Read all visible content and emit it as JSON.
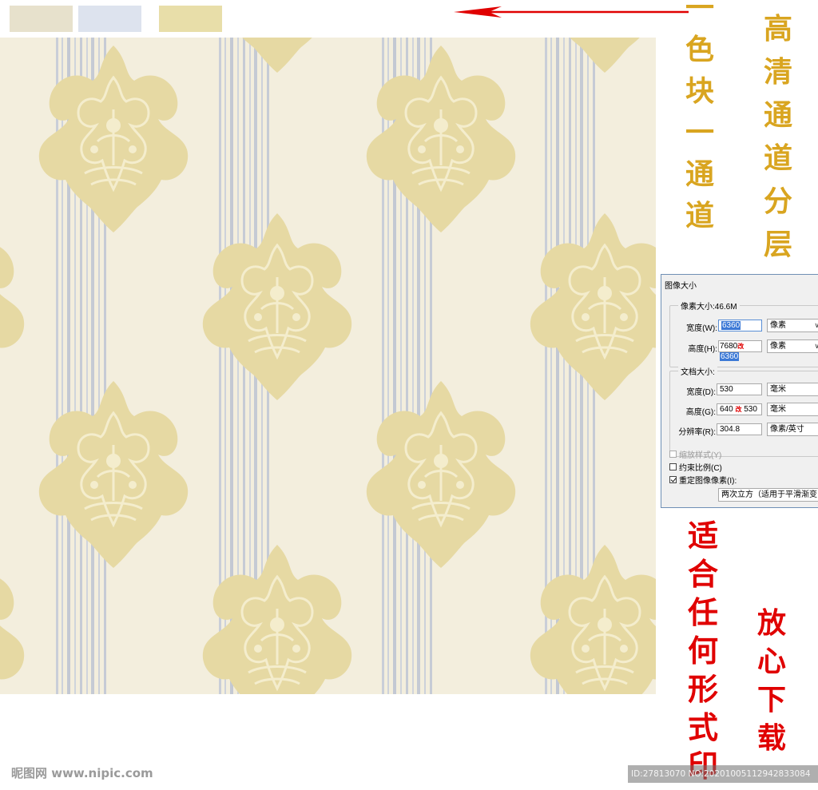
{
  "swatches": {
    "chip1": "#e7e1cc",
    "chip2": "#dde3ee",
    "chip3": "#e8dea9"
  },
  "pattern": {
    "background": "#f3eedd",
    "stripe_color": "#c7ccd6",
    "motif_color": "#e6d9a3",
    "motif_highlight": "#f4edcd"
  },
  "labels": {
    "gold_left": [
      "一",
      "色",
      "块",
      "一",
      "通",
      "道"
    ],
    "gold_right": [
      "高",
      "清",
      "通",
      "道",
      "分",
      "层"
    ],
    "red_left": [
      "适",
      "合",
      "任",
      "何",
      "形",
      "式",
      "印"
    ],
    "red_right": [
      "放",
      "心",
      "下",
      "载"
    ]
  },
  "dialog": {
    "title": "图像大小",
    "pixel_group": "像素大小:46.6M",
    "width_label": "宽度(W):",
    "width_value": "6360",
    "width_unit": "像素",
    "height_label": "高度(H):",
    "height_value_old": "7680",
    "height_annot": "改",
    "height_value": "6360",
    "height_unit": "像素",
    "doc_group": "文档大小:",
    "doc_width_label": "宽度(D):",
    "doc_width_value": "530",
    "doc_width_unit": "毫米",
    "doc_height_label": "高度(G):",
    "doc_height_value": "640",
    "doc_height_annot": "改",
    "doc_height_new": "530",
    "doc_height_unit": "毫米",
    "resolution_label": "分辨率(R):",
    "resolution_value": "304.8",
    "resolution_unit": "像素/英寸",
    "scale_styles": "缩放样式(Y)",
    "constrain": "约束比例(C)",
    "resample": "重定图像像素(I):",
    "resample_method": "两次立方（适用于平滑渐变"
  },
  "watermark": {
    "left": "昵图网 www.nipic.com",
    "right": "ID:27813070 NO:20201005112942833084"
  },
  "colors": {
    "gold_text": "#d9a520",
    "red_text": "#e00000",
    "arrow": "#e00000"
  }
}
